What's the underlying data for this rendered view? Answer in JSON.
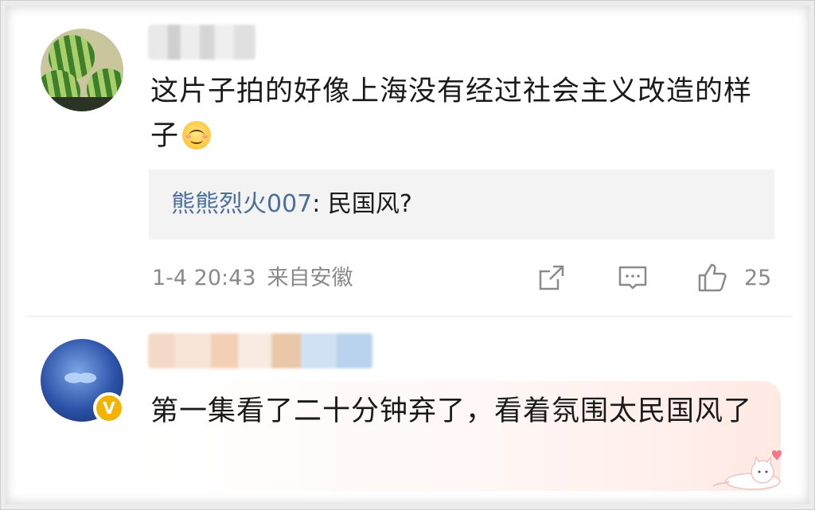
{
  "comments": [
    {
      "text": "这片子拍的好像上海没有经过社会主义改造的样子",
      "avatar": "watermelon-avatar",
      "reply": {
        "user": "熊熊烈火007",
        "separator": ": ",
        "text": "民国风?"
      },
      "time": "1-4 20:43",
      "location": "来自安徽",
      "likes": "25"
    },
    {
      "text": "第一集看了二十分钟弃了，看着氛围太民国风了",
      "avatar": "blue-avatar",
      "badge": "V"
    }
  ],
  "icons": [
    "share-icon",
    "comment-icon",
    "like-icon",
    "smile-emoji",
    "cat-sticker"
  ],
  "colors": {
    "reply_user": "#4a6f9c",
    "meta": "#8a8a8a",
    "reply_bg": "#f3f3f3",
    "badge": "#f2b400"
  }
}
